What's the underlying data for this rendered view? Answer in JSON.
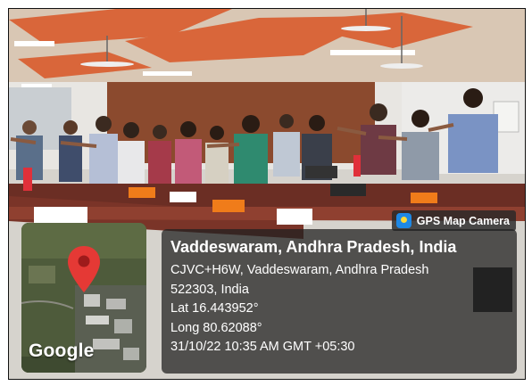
{
  "stamp": {
    "app_label": "GPS Map Camera",
    "icon": "gps-map-camera-app-icon",
    "map_watermark": "Google",
    "place_title": "Vaddeswaram, Andhra Pradesh, India",
    "address_line1": "CJVC+H6W, Vaddeswaram, Andhra Pradesh",
    "address_line2": "522303, India",
    "latitude": "Lat 16.443952°",
    "longitude": "Long 80.62088°",
    "timestamp": "31/10/22 10:35 AM GMT +05:30"
  },
  "colors": {
    "pin_red": "#e53935",
    "panel_bg": "#202020",
    "tag_icon_blue": "#1e88e5"
  }
}
